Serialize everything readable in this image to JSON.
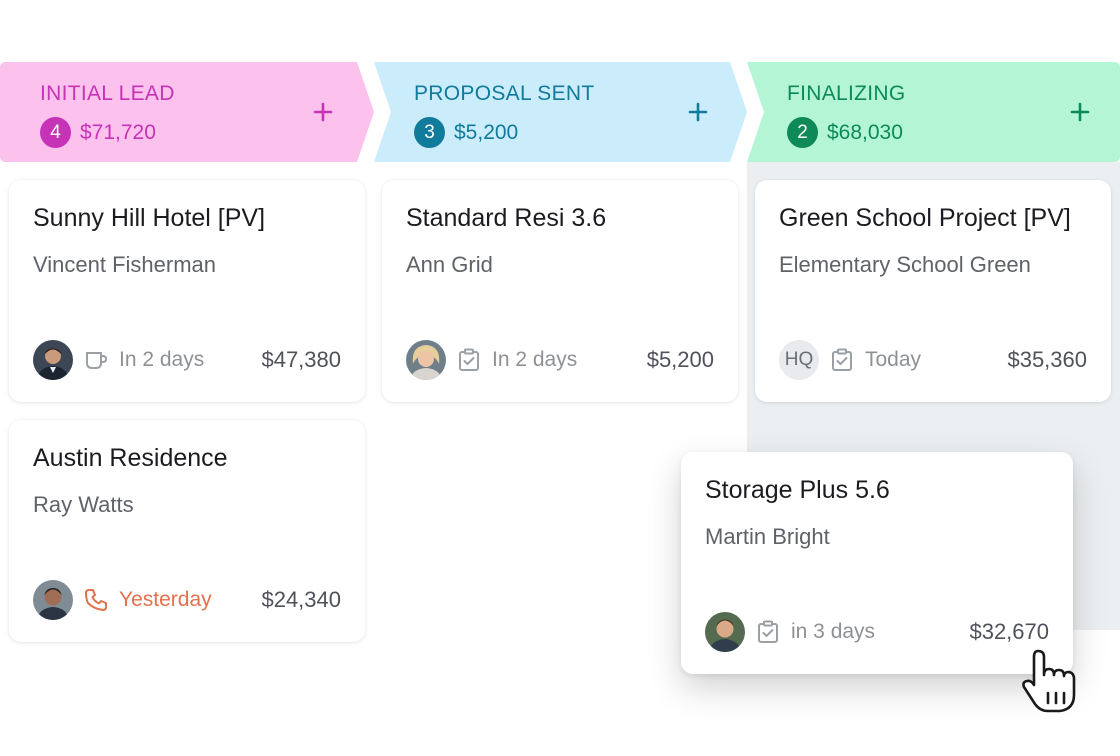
{
  "stages": [
    {
      "title": "INITIAL LEAD",
      "count": "4",
      "amount": "$71,720",
      "header_bg": "#fdc1ee",
      "accent": "#c633b6"
    },
    {
      "title": "PROPOSAL SENT",
      "count": "3",
      "amount": "$5,200",
      "header_bg": "#cbecfb",
      "accent": "#117b9b"
    },
    {
      "title": "FINALIZING",
      "count": "2",
      "amount": "$68,030",
      "header_bg": "#b4f5d5",
      "accent": "#0d8a58"
    }
  ],
  "deals": [
    {
      "title": "Sunny Hill Hotel [PV]",
      "contact": "Vincent Fisherman",
      "activity_icon": "coffee-icon",
      "due": "In 2 days",
      "amount": "$47,380"
    },
    {
      "title": "Austin Residence",
      "contact": "Ray Watts",
      "activity_icon": "phone-icon",
      "due": "Yesterday",
      "amount": "$24,340"
    },
    {
      "title": "Standard Resi 3.6",
      "contact": "Ann Grid",
      "activity_icon": "task-icon",
      "due": "In 2 days",
      "amount": "$5,200"
    },
    {
      "title": "Green School Project [PV]",
      "contact": "Elementary School Green",
      "avatar_initials": "HQ",
      "activity_icon": "task-icon",
      "due": "Today",
      "amount": "$35,360"
    },
    {
      "title": "Storage Plus 5.6",
      "contact": "Martin Bright",
      "activity_icon": "task-icon",
      "due": "in 3 days",
      "amount": "$32,670"
    }
  ],
  "colors": {
    "overdue": "#e2714d",
    "drop_zone": "#eceff1"
  }
}
